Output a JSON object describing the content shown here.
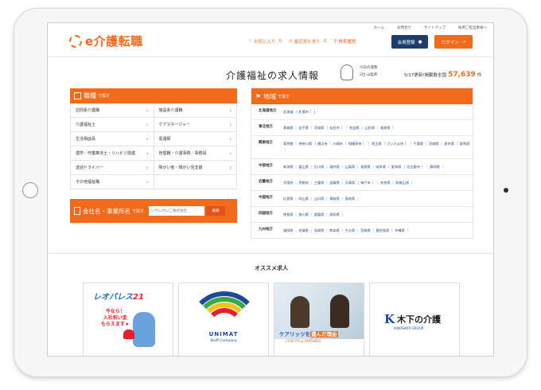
{
  "topnav": [
    "ホーム",
    "お問合せ",
    "サイトマップ",
    "採用ご担当者様へ"
  ],
  "logo": "e介護転職",
  "header": {
    "favorites_label": "お気に入り",
    "favorites_count": "0",
    "recent_label": "最近見た求人",
    "recent_count": "0",
    "search_history_label": "検索履歴",
    "register_label": "会員登録",
    "login_label": "ログイン"
  },
  "page_title": "介護福祉の求人情報",
  "stats": {
    "today_label": "今日の運勢",
    "today_rank": "2位",
    "today_pref": "山梨県",
    "update_text": "5/17更新!掲載数全国",
    "count": "57,639",
    "unit": "件"
  },
  "job_panel": {
    "title": "職種",
    "suffix": "で探す",
    "items": [
      "訪問系介護職",
      "施設系介護職",
      "介護福祉士",
      "ケアマネージャー",
      "生活相談員",
      "看護師",
      "理学／作業療法士・リハビリ関連",
      "管理職・介護事務／事務員",
      "送迎ドライバー",
      "障がい者・障がい児支援",
      "その他福祉職"
    ]
  },
  "company_search": {
    "title": "会社名・事業所名",
    "suffix": "で探す",
    "placeholder": "いかいかいご株式会社",
    "button": "検索"
  },
  "region_panel": {
    "title": "地域",
    "suffix": "で探す",
    "regions": [
      {
        "name": "北海道地方",
        "prefs": "北海道 ［ 札幌市 ］ |"
      },
      {
        "name": "東北地方",
        "prefs": "青森県 ｜ 岩手県 ｜ 宮城県 ［ 仙台市 ］ ｜ 秋田県 ｜ 山形県 ｜ 福島県 ｜"
      },
      {
        "name": "関東地方",
        "prefs": "東京都 ｜ 神奈川県 ［ 横浜市 ｜ 川崎市 ｜ 相模原市 ］ ｜ 埼玉県 ［ さいたま市 ］ ｜ 千葉県 ｜ 茨城県 ｜ 栃木県 ｜ 群馬県 ｜"
      },
      {
        "name": "中部地方",
        "prefs": "新潟県 ｜ 富山県 ｜ 石川県 ｜ 福井県 ｜ 山梨県 ｜ 長野県 ｜ 岐阜県 ｜ 愛知県 ［ 名古屋市 ］ ｜ 静岡県 ｜"
      },
      {
        "name": "近畿地方",
        "prefs": "大阪府 ｜ 京都府 ｜ 三重県 ｜ 滋賀県 ｜ 兵庫県 ［ 神戸市 ］ ｜ 奈良県 ｜ 和歌山県 ｜"
      },
      {
        "name": "中国地方",
        "prefs": "広島県 ｜ 岡山県 ｜ 山口県 ｜ 鳥取県 ｜ 島根県 ｜"
      },
      {
        "name": "四国地方",
        "prefs": "徳島県 ｜ 香川県 ｜ 愛媛県 ｜ 高知県 ｜"
      },
      {
        "name": "九州地方",
        "prefs": "福岡県 ｜ 佐賀県 ｜ 長崎県 ｜ 熊本県 ｜ 大分県 ｜ 宮崎県 ｜ 鹿児島県 ｜ 沖縄県 ｜"
      }
    ]
  },
  "recommended": {
    "title": "オススメ求人",
    "cards": [
      {
        "name": "レオパレス21",
        "title_main": "レオパレス",
        "title_num": "21",
        "msg1": "今なら！",
        "msg2": "入社祝い金",
        "msg3": "もらえます★"
      },
      {
        "name": "UNIMAT",
        "title_main": "UNIMAT",
        "sub": "Staff Company"
      },
      {
        "name": "ケアリッツ",
        "headline_pre": "ケアリッツを",
        "headline_hl": "選んだ理由",
        "sub": "CARE ITS & PARTNERS"
      },
      {
        "name": "木下の介護",
        "title_main": "木下の介護",
        "sub": "KINOSHITA GROUP"
      }
    ]
  },
  "colors": {
    "accent": "#f26b1d",
    "navy": "#1f3d6b"
  }
}
